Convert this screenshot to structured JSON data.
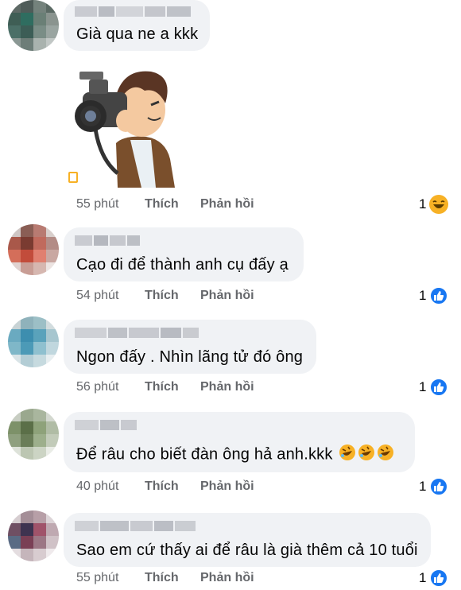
{
  "comments": [
    {
      "text": "Già qua ne a kkk",
      "time": "55 phút",
      "like_label": "Thích",
      "reply_label": "Phản hồi",
      "reaction_count": "1",
      "reaction_icon": "haha-icon",
      "sticker": "photographer-sticker"
    },
    {
      "text": "Cạo đi để thành anh cụ đấy ạ",
      "time": "54 phút",
      "like_label": "Thích",
      "reply_label": "Phản hồi",
      "reaction_count": "1",
      "reaction_icon": "like-icon"
    },
    {
      "text": "Ngon đấy . Nhìn lãng tử đó ông",
      "time": "56 phút",
      "like_label": "Thích",
      "reply_label": "Phản hồi",
      "reaction_count": "1",
      "reaction_icon": "like-icon"
    },
    {
      "text": "Để râu cho biết đàn ông hả anh.kkk",
      "time": "40 phút",
      "like_label": "Thích",
      "reply_label": "Phản hồi",
      "reaction_count": "1",
      "reaction_icon": "like-icon",
      "trailing_emoji": "rolling-laughing-emoji x3"
    },
    {
      "text": "Sao em cứ thấy ai để râu là già thêm cả 10 tuổi",
      "time": "55 phút",
      "like_label": "Thích",
      "reply_label": "Phản hồi",
      "reaction_count": "1",
      "reaction_icon": "like-icon"
    }
  ],
  "colors": {
    "bubble": "#f0f2f5",
    "meta": "#65676b",
    "like_blue": "#1877f2",
    "haha_yellow": "#f7b125"
  }
}
